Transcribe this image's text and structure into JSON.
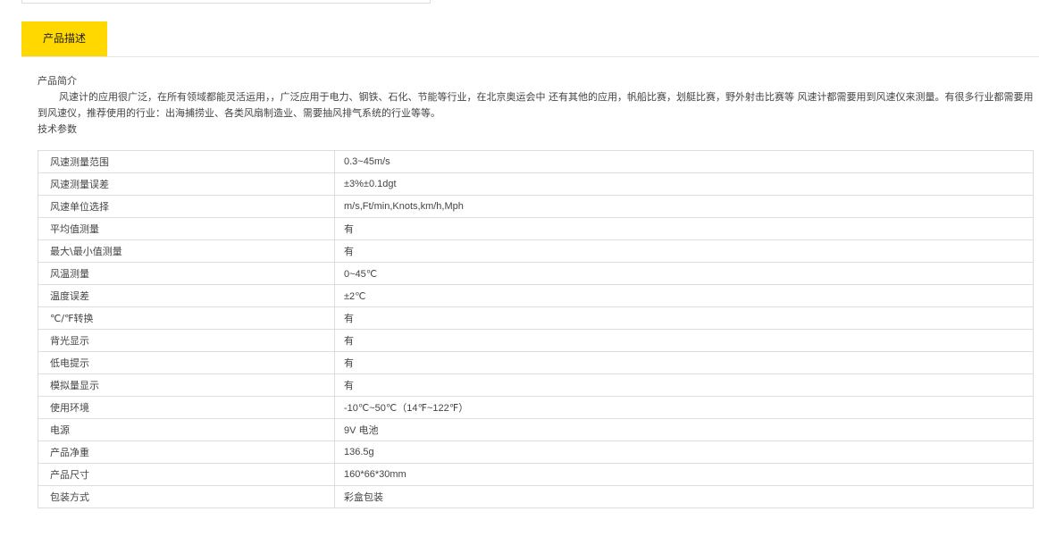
{
  "tabs": {
    "active_label": "产品描述"
  },
  "description": {
    "intro_heading": "产品简介",
    "intro_text": "风速计的应用很广泛，在所有领域都能灵活运用，，广泛应用于电力、钢铁、石化、节能等行业，在北京奥运会中 还有其他的应用，帆船比赛，划艇比赛，野外射击比赛等 风速计都需要用到风速仪来测量。有很多行业都需要用到风速仪，推荐使用的行业：出海捕捞业、各类风扇制造业、需要抽风排气系统的行业等等。",
    "params_heading": "技术参数"
  },
  "specs": [
    {
      "key": "风速测量范围",
      "value": "0.3~45m/s"
    },
    {
      "key": "风速测量误差",
      "value": "±3%±0.1dgt"
    },
    {
      "key": "风速单位选择",
      "value": "m/s,Ft/min,Knots,km/h,Mph"
    },
    {
      "key": "平均值测量",
      "value": "有"
    },
    {
      "key": "最大\\最小值测量",
      "value": "有"
    },
    {
      "key": "风温测量",
      "value": "0~45℃"
    },
    {
      "key": "温度误差",
      "value": "±2℃"
    },
    {
      "key": "℃/℉转换",
      "value": "有"
    },
    {
      "key": "背光显示",
      "value": "有"
    },
    {
      "key": "低电提示",
      "value": "有"
    },
    {
      "key": "模拟量显示",
      "value": "有"
    },
    {
      "key": "使用环境",
      "value": "-10℃~50℃（14℉~122℉）"
    },
    {
      "key": "电源",
      "value": "9V  电池"
    },
    {
      "key": "产品净重",
      "value": "136.5g"
    },
    {
      "key": "产品尺寸",
      "value": "160*66*30mm"
    },
    {
      "key": "包装方式",
      "value": " 彩盒包装"
    }
  ]
}
